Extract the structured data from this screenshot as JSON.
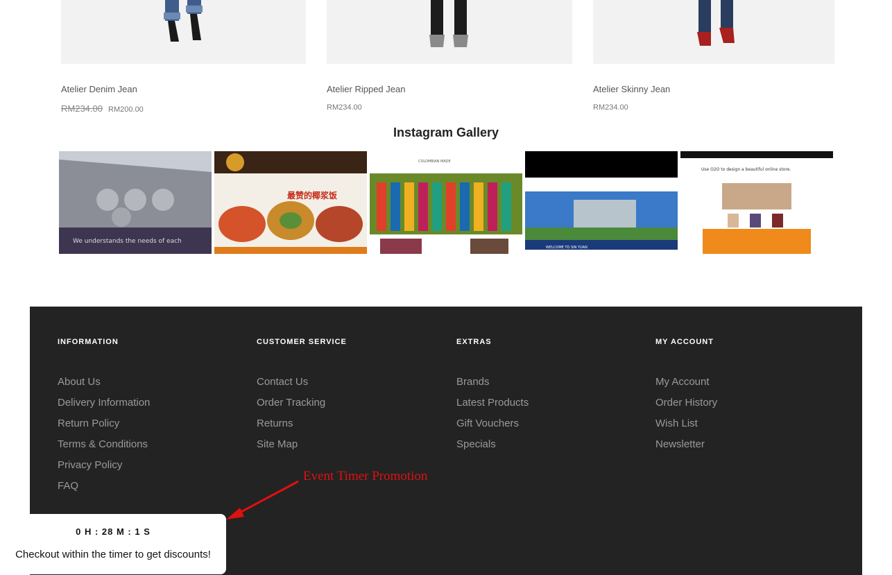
{
  "products": [
    {
      "name": "Atelier Denim Jean",
      "old_price": "RM234.00",
      "price": "RM200.00"
    },
    {
      "name": "Atelier Ripped Jean",
      "old_price": "",
      "price": "RM234.00"
    },
    {
      "name": "Atelier Skinny Jean",
      "old_price": "",
      "price": "RM234.00"
    }
  ],
  "instagram": {
    "title": "Instagram Gallery",
    "items": [
      {
        "caption": "We understands the needs of each"
      },
      {
        "caption": "最赞的椰浆饭"
      },
      {
        "caption": "COLOMBIAN MADE"
      },
      {
        "caption": "WELCOME TO SIN YUAN"
      },
      {
        "caption": "Use O2O to design a beautiful online store."
      }
    ]
  },
  "footer": {
    "columns": [
      {
        "heading": "INFORMATION",
        "links": [
          "About Us",
          "Delivery Information",
          "Return Policy",
          "Terms & Conditions",
          "Privacy Policy",
          "FAQ"
        ]
      },
      {
        "heading": "CUSTOMER SERVICE",
        "links": [
          "Contact Us",
          "Order Tracking",
          "Returns",
          "Site Map"
        ]
      },
      {
        "heading": "EXTRAS",
        "links": [
          "Brands",
          "Latest Products",
          "Gift Vouchers",
          "Specials"
        ]
      },
      {
        "heading": "MY ACCOUNT",
        "links": [
          "My Account",
          "Order History",
          "Wish List",
          "Newsletter"
        ]
      }
    ]
  },
  "annotation": {
    "label": "Event Timer Promotion",
    "color": "#e01010"
  },
  "timer": {
    "countdown": "0 H : 28 M : 1 S",
    "message": "Checkout within the timer to get discounts!"
  },
  "colors": {
    "footer_bg": "#232323",
    "footer_link": "#9a9a9a",
    "heading": "#ffffff"
  }
}
